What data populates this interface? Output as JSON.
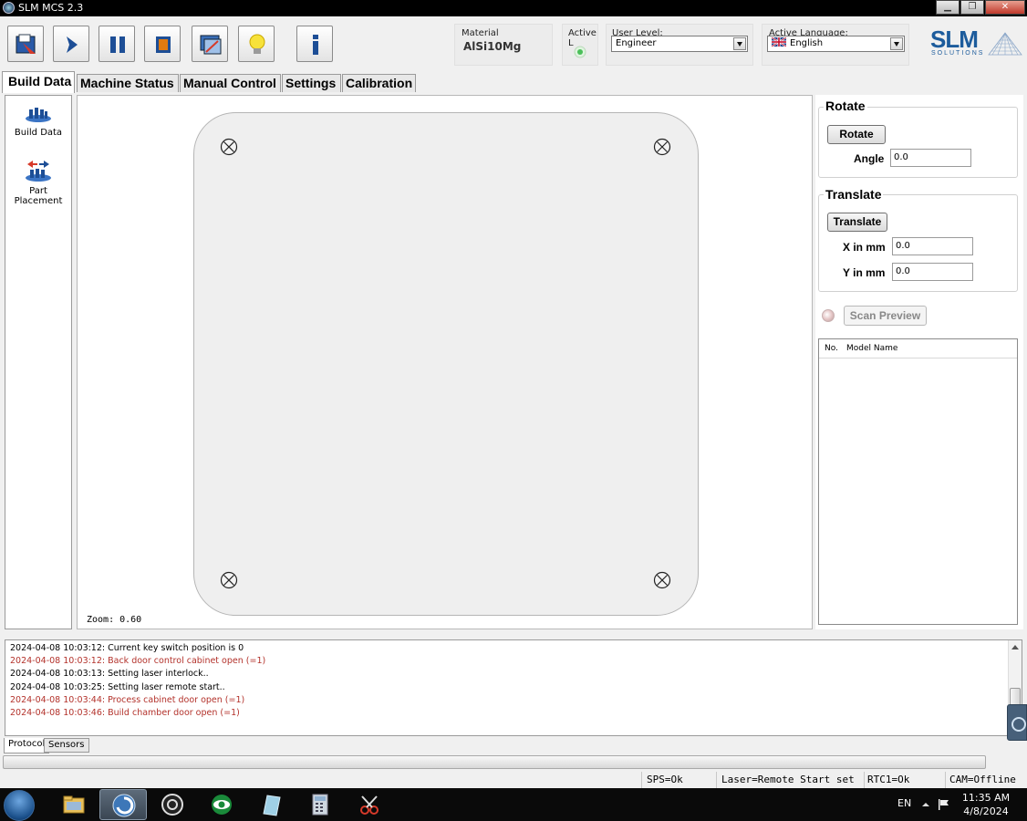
{
  "window": {
    "title": "SLM MCS 2.3"
  },
  "toolbar": {
    "buttons": [
      "open-build-icon",
      "start-icon",
      "pause-icon",
      "stop-icon",
      "preview-icon",
      "light-icon",
      "info-icon"
    ],
    "material": {
      "label": "Material",
      "value": "AlSi10Mg"
    },
    "active_laser": {
      "label": "Active L"
    },
    "user_level": {
      "label": "User Level:",
      "value": "Engineer"
    },
    "language": {
      "label": "Active Language:",
      "value": "English"
    },
    "logo": {
      "main": "SLM",
      "sub": "SOLUTIONS"
    }
  },
  "tabs": [
    "Build Data",
    "Machine Status",
    "Manual Control",
    "Settings",
    "Calibration"
  ],
  "left_panel": {
    "items": [
      {
        "label": "Build Data",
        "icon": "build-data-icon"
      },
      {
        "label": "Part Placement",
        "icon": "part-placement-icon"
      }
    ]
  },
  "canvas": {
    "zoom": "Zoom: 0.60"
  },
  "right_panel": {
    "rotate": {
      "title": "Rotate",
      "button": "Rotate",
      "angle_label": "Angle",
      "angle_value": "0.0"
    },
    "translate": {
      "title": "Translate",
      "button": "Translate",
      "x_label": "X in mm",
      "x_value": "0.0",
      "y_label": "Y in mm",
      "y_value": "0.0"
    },
    "scan_preview": "Scan Preview",
    "models_table": {
      "columns": [
        "No.",
        "Model Name"
      ],
      "rows": []
    }
  },
  "protocol": {
    "lines": [
      {
        "text": "2024-04-08 10:03:12: Current key switch position is 0",
        "level": "info"
      },
      {
        "text": "2024-04-08 10:03:12: Back door control cabinet open (=1)",
        "level": "error"
      },
      {
        "text": "2024-04-08 10:03:13: Setting laser interlock..",
        "level": "info"
      },
      {
        "text": "2024-04-08 10:03:25: Setting laser remote start..",
        "level": "info"
      },
      {
        "text": "2024-04-08 10:03:44: Process cabinet door open (=1)",
        "level": "error"
      },
      {
        "text": "2024-04-08 10:03:46: Build chamber door open (=1)",
        "level": "error"
      }
    ],
    "tabs": [
      "Protocol",
      "Sensors"
    ]
  },
  "status_bar": {
    "sps": "SPS=Ok",
    "laser": "Laser=Remote Start set",
    "rtc": "RTC1=Ok",
    "cam": "CAM=Offline"
  },
  "taskbar": {
    "lang": "EN",
    "time": "11:35 AM",
    "date": "4/8/2024"
  },
  "colors": {
    "error_text": "#b3322b",
    "logo_blue": "#1d5c9c",
    "tool_blue": "#1d4e96",
    "stop_orange": "#e07a10"
  }
}
